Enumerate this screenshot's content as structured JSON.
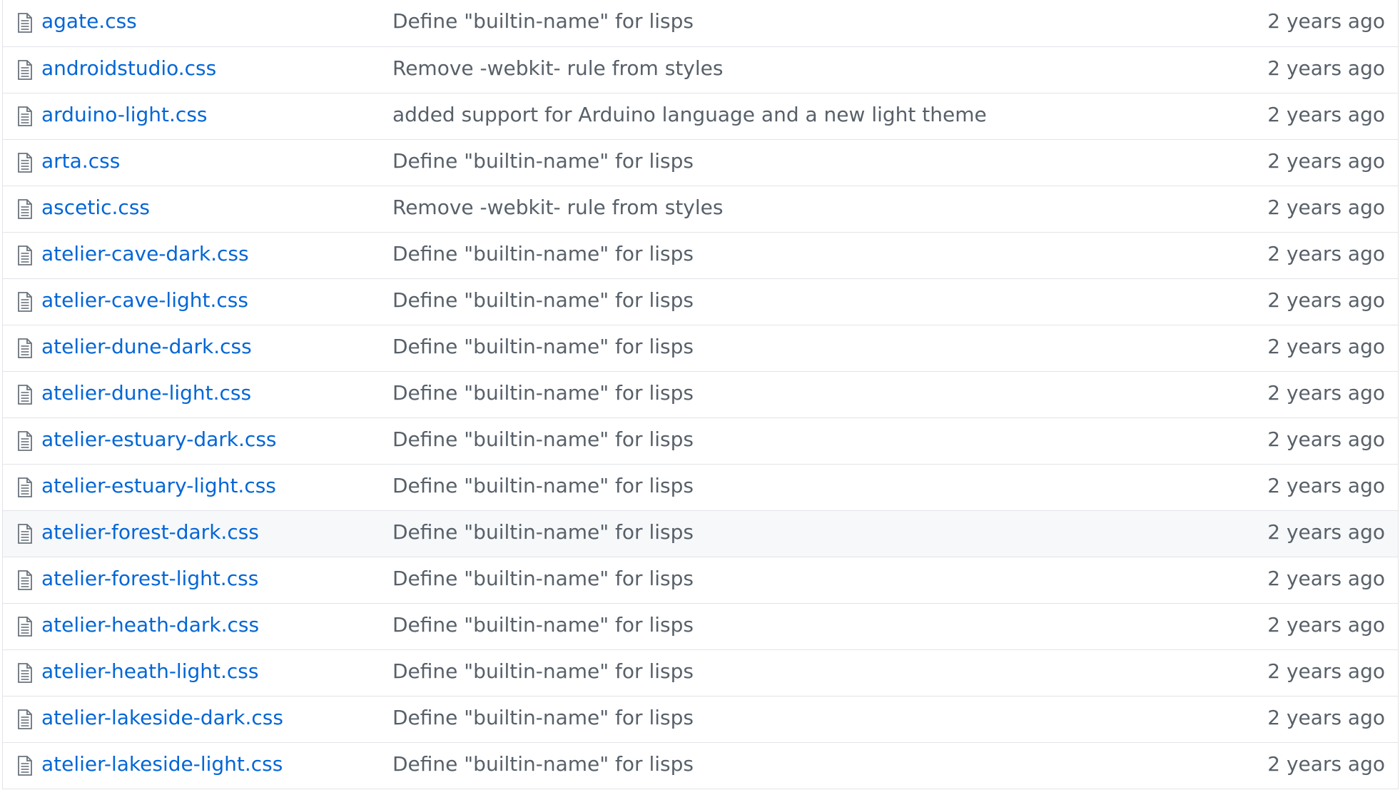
{
  "files": [
    {
      "name": "agate.css",
      "message": "Define \"builtin-name\" for lisps",
      "age": "2 years ago"
    },
    {
      "name": "androidstudio.css",
      "message": "Remove -webkit- rule from styles",
      "age": "2 years ago"
    },
    {
      "name": "arduino-light.css",
      "message": "added support for Arduino language and a new light theme",
      "age": "2 years ago"
    },
    {
      "name": "arta.css",
      "message": "Define \"builtin-name\" for lisps",
      "age": "2 years ago"
    },
    {
      "name": "ascetic.css",
      "message": "Remove -webkit- rule from styles",
      "age": "2 years ago"
    },
    {
      "name": "atelier-cave-dark.css",
      "message": "Define \"builtin-name\" for lisps",
      "age": "2 years ago"
    },
    {
      "name": "atelier-cave-light.css",
      "message": "Define \"builtin-name\" for lisps",
      "age": "2 years ago"
    },
    {
      "name": "atelier-dune-dark.css",
      "message": "Define \"builtin-name\" for lisps",
      "age": "2 years ago"
    },
    {
      "name": "atelier-dune-light.css",
      "message": "Define \"builtin-name\" for lisps",
      "age": "2 years ago"
    },
    {
      "name": "atelier-estuary-dark.css",
      "message": "Define \"builtin-name\" for lisps",
      "age": "2 years ago"
    },
    {
      "name": "atelier-estuary-light.css",
      "message": "Define \"builtin-name\" for lisps",
      "age": "2 years ago"
    },
    {
      "name": "atelier-forest-dark.css",
      "message": "Define \"builtin-name\" for lisps",
      "age": "2 years ago",
      "hovered": true
    },
    {
      "name": "atelier-forest-light.css",
      "message": "Define \"builtin-name\" for lisps",
      "age": "2 years ago"
    },
    {
      "name": "atelier-heath-dark.css",
      "message": "Define \"builtin-name\" for lisps",
      "age": "2 years ago"
    },
    {
      "name": "atelier-heath-light.css",
      "message": "Define \"builtin-name\" for lisps",
      "age": "2 years ago"
    },
    {
      "name": "atelier-lakeside-dark.css",
      "message": "Define \"builtin-name\" for lisps",
      "age": "2 years ago"
    },
    {
      "name": "atelier-lakeside-light.css",
      "message": "Define \"builtin-name\" for lisps",
      "age": "2 years ago"
    }
  ],
  "icons": {
    "file": "file-icon"
  },
  "colors": {
    "link": "#0366d6",
    "muted": "#586069",
    "border": "#e1e4e8",
    "hover": "#f6f8fa"
  }
}
